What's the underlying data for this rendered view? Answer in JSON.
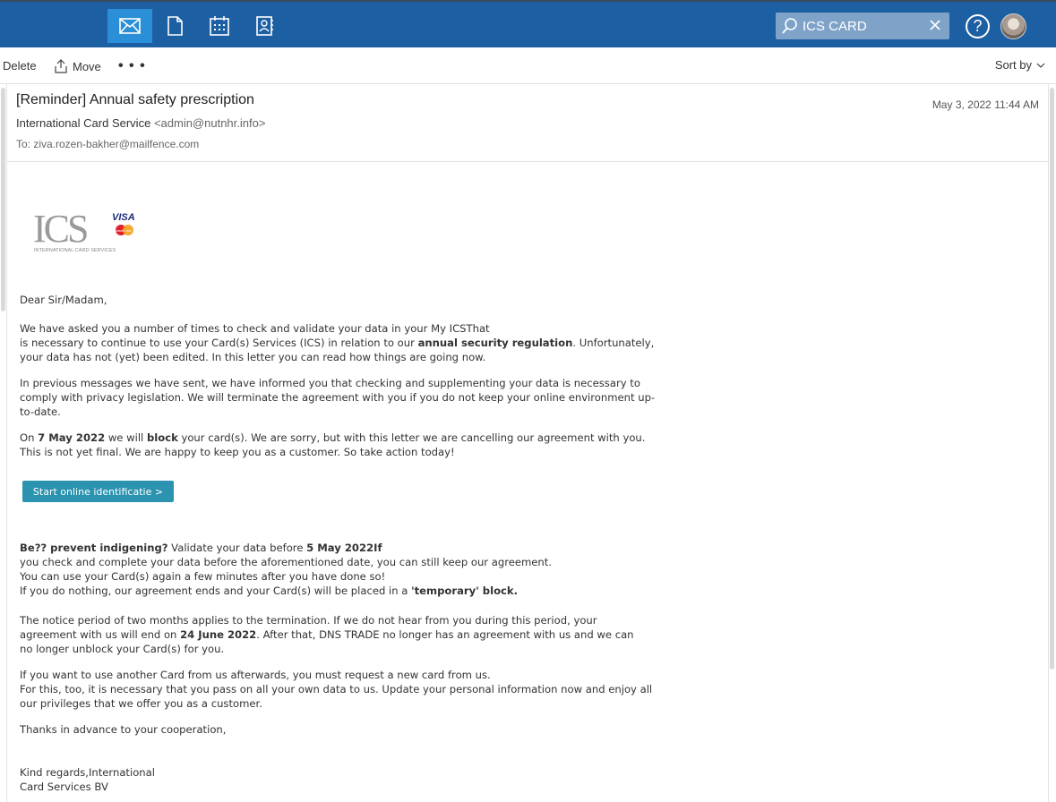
{
  "nav": {
    "mail_icon": "mail-icon",
    "docs_icon": "document-icon",
    "calendar_icon": "calendar-icon",
    "contacts_icon": "contacts-icon"
  },
  "search": {
    "value": "ICS CARD"
  },
  "help_label": "?",
  "toolbar": {
    "delete_label": "Delete",
    "move_label": "Move",
    "more_label": "• • •",
    "sort_label": "Sort by"
  },
  "email": {
    "subject": "[Reminder] Annual safety prescription",
    "date": "May 3, 2022 11:44 AM",
    "from_name": "International Card Service",
    "from_addr": "<admin@nutnhr.info>",
    "to": "To: ziva.rozen-bakher@mailfence.com"
  },
  "logo": {
    "text": "ICS",
    "visa": "VISA",
    "mastercard": "MasterCard",
    "tagline": "INTERNATIONAL CARD SERVICES"
  },
  "body": {
    "greeting": "Dear Sir/Madam,",
    "p1_a": "We have asked you a number of times to check and validate your data in your My ICSThat",
    "p1_b_pre": "is necessary to continue to use your Card(s) Services (ICS) in relation to our ",
    "p1_b_bold": "annual security regulation",
    "p1_b_post": ". Unfortunately,",
    "p1_c": "your data has not (yet) been edited. In this letter you can read how things are going now.",
    "p2_a": "In previous messages we have sent, we have informed you that checking and supplementing your data is necessary to",
    "p2_b": "comply with privacy legislation. We will terminate the agreement with you if you do not keep your online environment up-",
    "p2_c": "to-date.",
    "p3_pre": "On ",
    "p3_bold1": "7 May 2022",
    "p3_mid": " we will ",
    "p3_bold2": "block",
    "p3_post": " your card(s). We are sorry, but with this letter we are cancelling our agreement with you.",
    "p3_b": "This is not yet final. We are happy to keep you as a customer. So take action today!",
    "cta_label": "Start online identificatie >",
    "p4_bold1": "Be?? prevent indigening?",
    "p4_mid": " Validate your data before ",
    "p4_bold2": "5 May 2022If",
    "p4_b": "you check and complete your data before the aforementioned date, you can still keep our agreement.",
    "p4_c": "You can use your Card(s) again a few minutes after you have done so!",
    "p4_d_pre": "If you do nothing, our agreement ends and your Card(s) will be placed in a ",
    "p4_d_bold": "'temporary' block.",
    "p5_a": "The notice period of two months applies to the termination. If we do not hear from you during this period, your",
    "p5_b_pre": "agreement with us will end on ",
    "p5_b_bold": "24 June 2022",
    "p5_b_post": ". After that, DNS TRADE no longer has an agreement with us and we can",
    "p5_c": "no longer unblock your Card(s) for you.",
    "p6_a": "If you want to use another Card from us afterwards, you must request a new card from us.",
    "p6_b": "For this, too, it is necessary that you pass on all your own data to us. Update your personal information now and enjoy all",
    "p6_c": "our privileges that we offer you as a customer.",
    "thanks": "Thanks in advance to your cooperation,",
    "sign_a": "Kind regards,International",
    "sign_b": "Card Services BV"
  }
}
